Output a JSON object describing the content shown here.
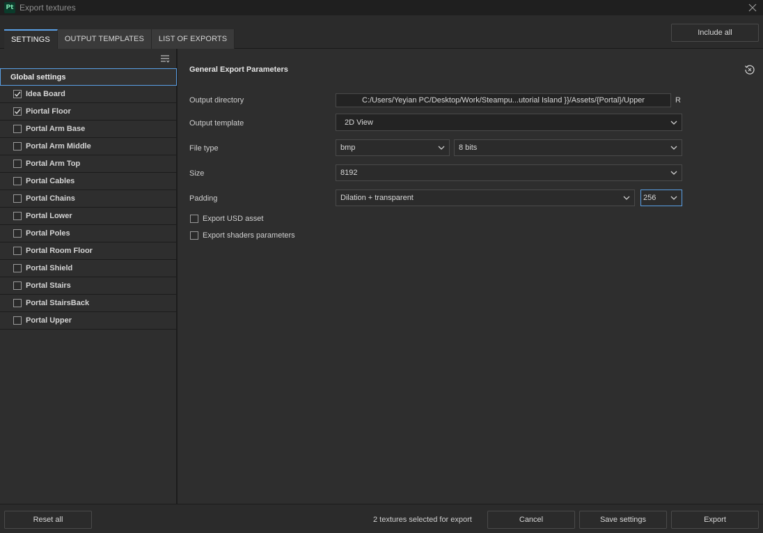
{
  "window": {
    "app_logo": "Pt",
    "title": "Export textures"
  },
  "tabs": [
    {
      "label": "SETTINGS",
      "active": true
    },
    {
      "label": "OUTPUT TEMPLATES",
      "active": false
    },
    {
      "label": "LIST OF EXPORTS",
      "active": false
    }
  ],
  "toolbar": {
    "include_all_label": "Include all"
  },
  "left_panel": {
    "global_settings_label": "Global settings",
    "items": [
      {
        "label": "Idea Board",
        "checked": true
      },
      {
        "label": "Piortal Floor",
        "checked": true
      },
      {
        "label": "Portal Arm Base",
        "checked": false
      },
      {
        "label": "Portal Arm Middle",
        "checked": false
      },
      {
        "label": "Portal Arm Top",
        "checked": false
      },
      {
        "label": "Portal Cables",
        "checked": false
      },
      {
        "label": "Portal Chains",
        "checked": false
      },
      {
        "label": "Portal Lower",
        "checked": false
      },
      {
        "label": "Portal Poles",
        "checked": false
      },
      {
        "label": "Portal Room Floor",
        "checked": false
      },
      {
        "label": "Portal Shield",
        "checked": false
      },
      {
        "label": "Portal Stairs",
        "checked": false
      },
      {
        "label": "Portal StairsBack",
        "checked": false
      },
      {
        "label": "Portal Upper",
        "checked": false
      }
    ]
  },
  "params": {
    "section_title": "General Export Parameters",
    "output_directory": {
      "label": "Output directory",
      "value": "C:/Users/Yeyian PC/Desktop/Work/Steampu...utorial Island }}/Assets/{Portal}/Upper",
      "suffix": "R"
    },
    "output_template": {
      "label": "Output template",
      "value": "2D View"
    },
    "file_type": {
      "label": "File type",
      "format": "bmp",
      "bit_depth": "8 bits"
    },
    "size": {
      "label": "Size",
      "value": "8192"
    },
    "padding": {
      "label": "Padding",
      "mode": "Dilation + transparent",
      "amount": "256"
    },
    "export_usd": {
      "label": "Export USD asset",
      "checked": false
    },
    "export_shaders": {
      "label": "Export shaders parameters",
      "checked": false
    }
  },
  "footer": {
    "reset_all_label": "Reset all",
    "status": "2 textures selected for export",
    "cancel_label": "Cancel",
    "save_settings_label": "Save settings",
    "export_label": "Export"
  },
  "colors": {
    "accent": "#5aa0e6",
    "background": "#2e2e2e",
    "titlebar": "#1f1f1f"
  }
}
